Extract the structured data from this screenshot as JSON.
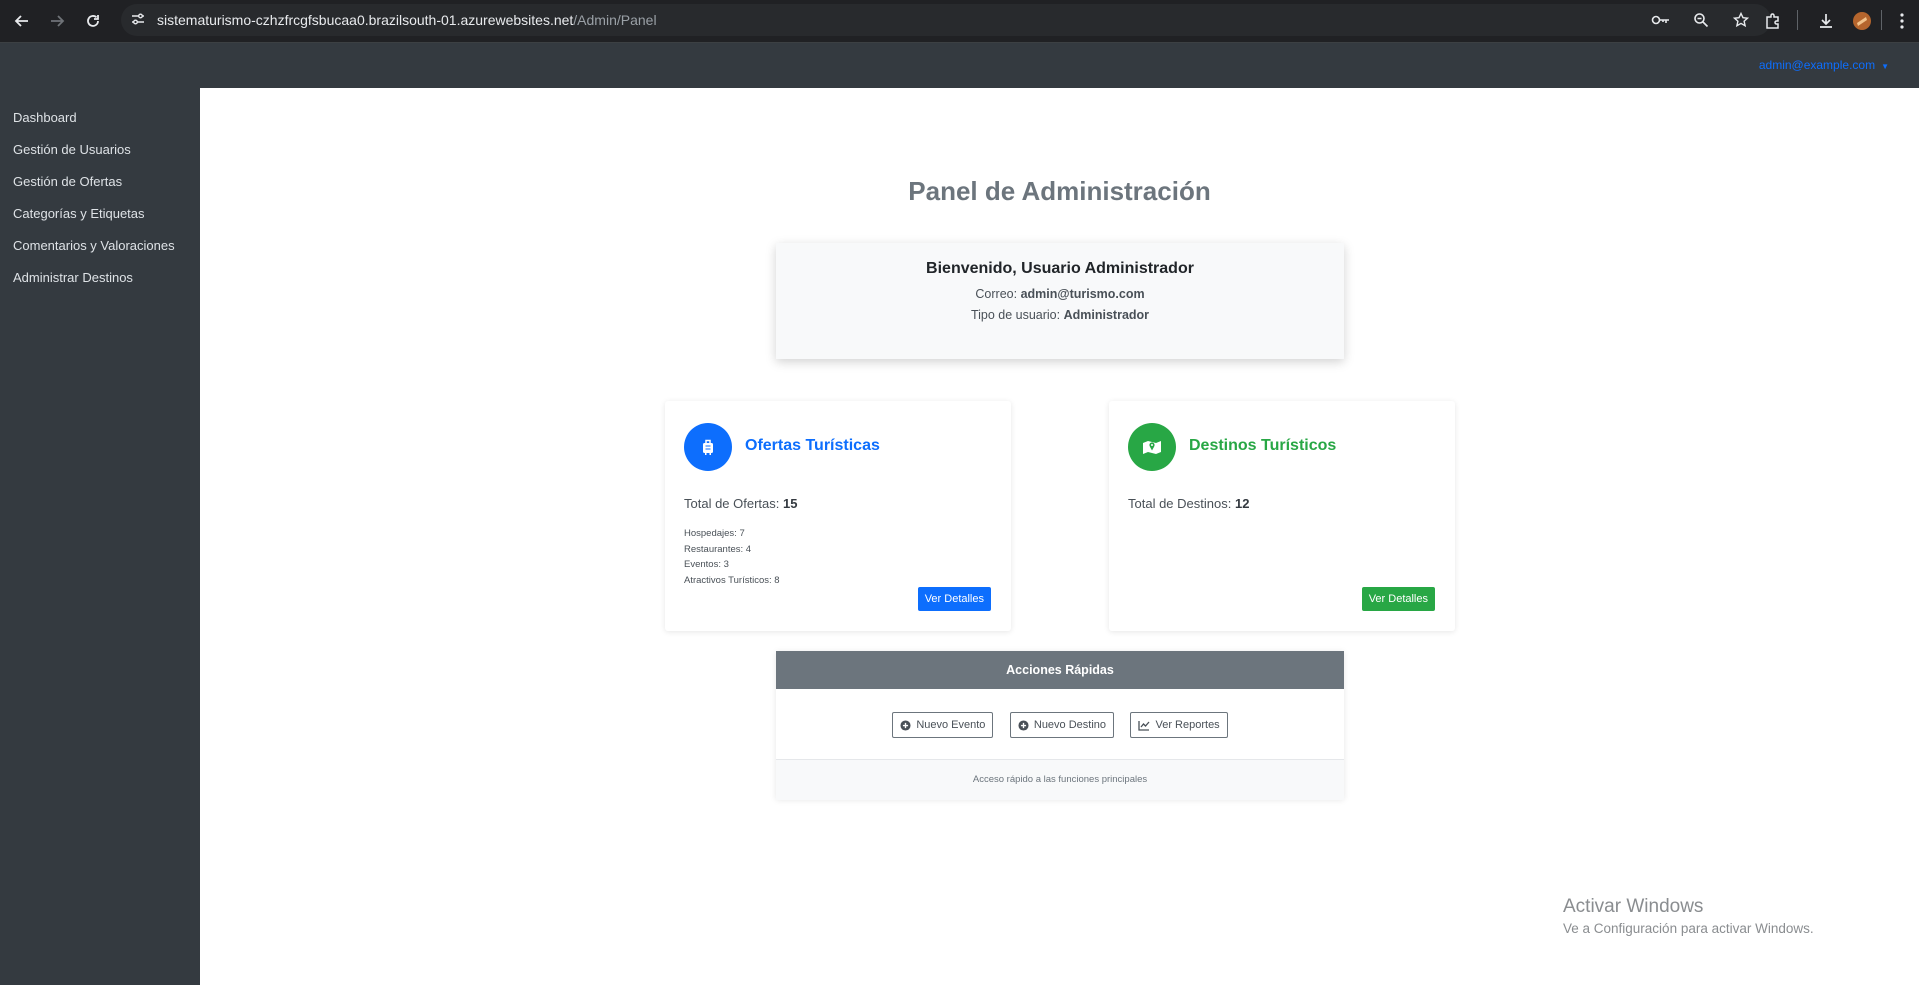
{
  "browser": {
    "url_host": "sistematurismo-czhzfrcgfsbucaa0.brazilsouth-01.azurewebsites.net",
    "url_path": "/Admin/Panel"
  },
  "topbar": {
    "user_email": "admin@example.com"
  },
  "sidebar": {
    "items": [
      {
        "label": "Dashboard"
      },
      {
        "label": "Gestión de Usuarios"
      },
      {
        "label": "Gestión de Ofertas"
      },
      {
        "label": "Categorías y Etiquetas"
      },
      {
        "label": "Comentarios y Valoraciones"
      },
      {
        "label": "Administrar Destinos"
      }
    ]
  },
  "main": {
    "title": "Panel de Administración",
    "welcome": {
      "title": "Bienvenido, Usuario Administrador",
      "email_label": "Correo:",
      "email": "admin@turismo.com",
      "type_label": "Tipo de usuario:",
      "type": "Administrador"
    },
    "ofertas": {
      "title": "Ofertas Turísticas",
      "total_label": "Total de Ofertas:",
      "total": "15",
      "breakdown": [
        "Hospedajes: 7",
        "Restaurantes: 4",
        "Eventos: 3",
        "Atractivos Turísticos: 8"
      ],
      "button": "Ver Detalles"
    },
    "destinos": {
      "title": "Destinos Turísticos",
      "total_label": "Total de Destinos:",
      "total": "12",
      "button": "Ver Detalles"
    },
    "quick_actions": {
      "title": "Acciones Rápidas",
      "buttons": [
        {
          "label": "Nuevo Evento",
          "icon": "plus-circle-icon"
        },
        {
          "label": "Nuevo Destino",
          "icon": "plus-circle-icon"
        },
        {
          "label": "Ver Reportes",
          "icon": "chart-line-icon"
        }
      ],
      "footer": "Acceso rápido a las funciones principales"
    }
  },
  "watermark": {
    "line1": "Activar Windows",
    "line2": "Ve a Configuración para activar Windows."
  },
  "colors": {
    "primary": "#0d6efd",
    "success": "#28a745",
    "secondary": "#6c757d",
    "dark": "#343a40"
  }
}
